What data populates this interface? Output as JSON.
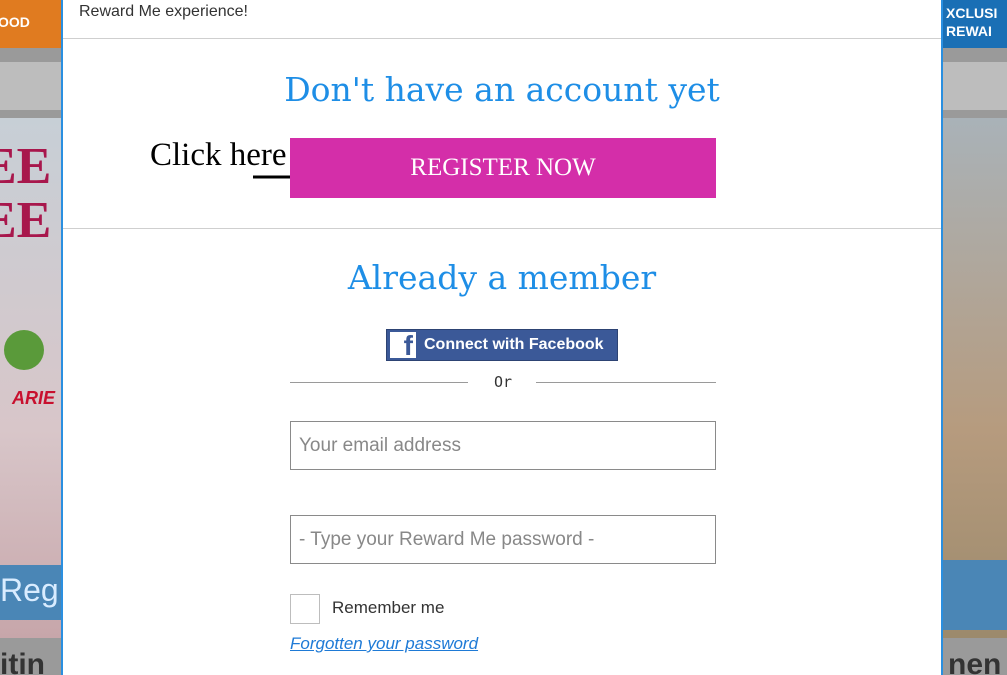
{
  "background": {
    "left_tab": "OOD",
    "right_tab": "XCLUSI REWAI",
    "left_big": "EE\nEE",
    "left_brand": "ARIE",
    "left_reg": "Reg",
    "left_bottom": "itin",
    "right_bottom": "nen"
  },
  "modal": {
    "top_text": "Reward Me experience!",
    "register_heading": "Don't have an account yet",
    "register_button": "REGISTER NOW",
    "annotation_text": "Click here",
    "member_heading": "Already a member",
    "facebook_button": "Connect with Facebook",
    "or_text": "Or",
    "email_placeholder": "Your email address",
    "password_placeholder": "- Type your Reward Me password -",
    "remember_label": "Remember me",
    "forgot_link": "Forgotten your password"
  },
  "colors": {
    "heading": "#1e8ee6",
    "register_button": "#d42ea9",
    "facebook": "#3b5998",
    "modal_border": "#2a8fe0"
  }
}
